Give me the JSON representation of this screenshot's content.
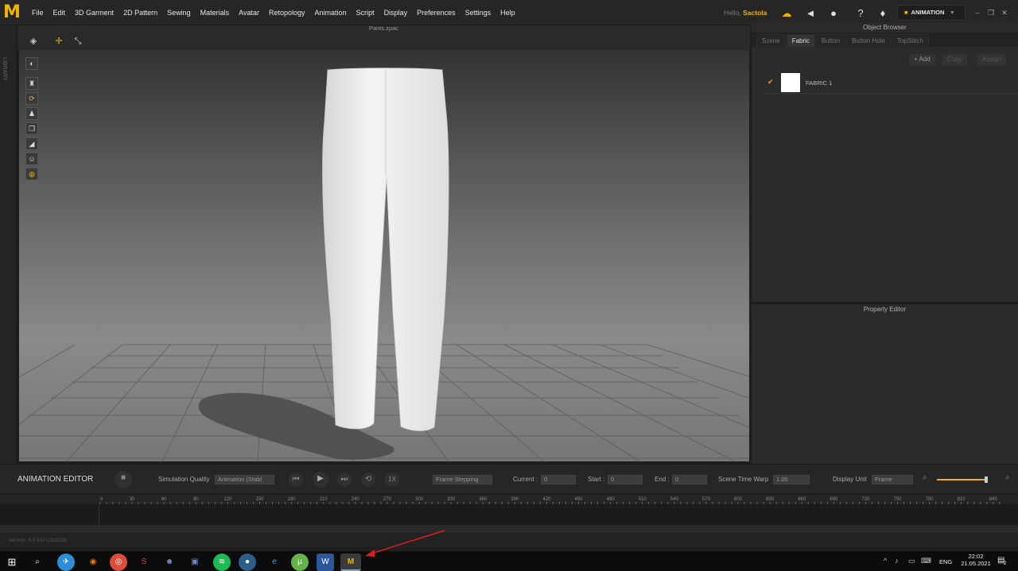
{
  "app": {
    "logo": "M"
  },
  "menu": [
    "File",
    "Edit",
    "3D Garment",
    "2D Pattern",
    "Sewing",
    "Materials",
    "Avatar",
    "Retopology",
    "Animation",
    "Script",
    "Display",
    "Preferences",
    "Settings",
    "Help"
  ],
  "header": {
    "hello_prefix": "Hello,",
    "user": "Sactola",
    "mode_label": "ANIMATION"
  },
  "sidebar": {
    "library_label": "LIBRARY"
  },
  "viewport": {
    "title": "Pants.zpac"
  },
  "object_browser": {
    "title": "Object Browser",
    "tabs": [
      "Scene",
      "Fabric",
      "Button",
      "Button Hole",
      "TopStitch"
    ],
    "active_tab": "Fabric",
    "buttons": {
      "add": "Add",
      "copy": "Copy",
      "assign": "Assign"
    },
    "fabrics": [
      {
        "name": "FABRIC 1",
        "color": "#ffffff"
      }
    ]
  },
  "property_editor": {
    "title": "Property Editor"
  },
  "animation_editor": {
    "title": "ANIMATION EDITOR",
    "sim_quality_label": "Simulation Quality",
    "sim_quality_value": "Animation (Stabl",
    "speed": "1X",
    "frame_mode": "Frame Stepping",
    "current_label": "Current :",
    "current_value": "0",
    "start_label": "Start :",
    "start_value": "0",
    "end_label": "End :",
    "end_value": "0",
    "warp_label": "Scene Time Warp",
    "warp_value": "1.00",
    "unit_label": "Display Unit",
    "unit_value": "Frame"
  },
  "ruler": [
    "0",
    "30",
    "60",
    "90",
    "120",
    "150",
    "180",
    "210",
    "240",
    "270",
    "300",
    "330",
    "360",
    "390",
    "420",
    "450",
    "480",
    "510",
    "540",
    "570",
    "600",
    "630",
    "660",
    "690",
    "720",
    "750",
    "780",
    "810",
    "840"
  ],
  "status": {
    "version": "Version: 6.0.537 (r32823)"
  },
  "taskbar": {
    "apps": [
      "telegram",
      "blender",
      "chrome",
      "office",
      "discord",
      "save",
      "spotify",
      "media",
      "edge",
      "utorrent",
      "word",
      "marvelous"
    ],
    "lang": "ENG",
    "time": "22:02",
    "date": "21.05.2021",
    "notif": "2"
  },
  "accent_color": "#f0b400"
}
